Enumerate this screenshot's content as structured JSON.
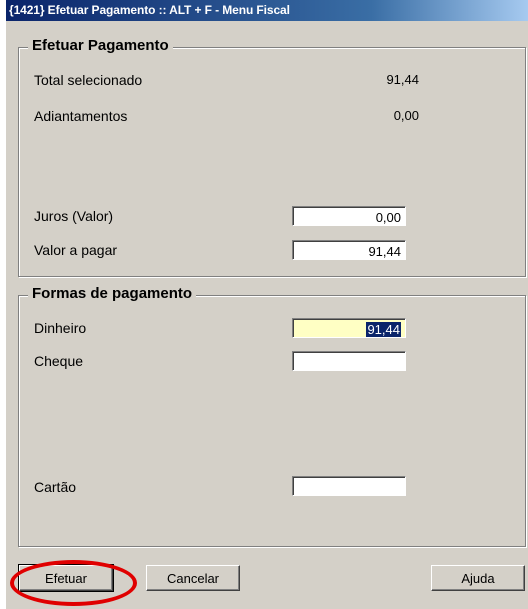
{
  "window": {
    "title": "{1421} Efetuar Pagamento :: ALT + F - Menu Fiscal"
  },
  "pagamento": {
    "legend": "Efetuar Pagamento",
    "total_label": "Total selecionado",
    "total_value": "91,44",
    "adiantamentos_label": "Adiantamentos",
    "adiantamentos_value": "0,00",
    "juros_label": "Juros (Valor)",
    "juros_value": "0,00",
    "valor_pagar_label": "Valor a pagar",
    "valor_pagar_value": "91,44"
  },
  "formas": {
    "legend": "Formas de pagamento",
    "dinheiro_label": "Dinheiro",
    "dinheiro_value": "91,44",
    "cheque_label": "Cheque",
    "cheque_value": "",
    "cartao_label": "Cartão",
    "cartao_value": ""
  },
  "buttons": {
    "efetuar": "Efetuar",
    "cancelar": "Cancelar",
    "ajuda": "Ajuda"
  },
  "colors": {
    "title_start": "#0a246a",
    "title_end": "#a6caf0",
    "window_bg": "#d4d0c8",
    "active_field": "#ffffc4",
    "annotation_ring": "#e00000"
  }
}
